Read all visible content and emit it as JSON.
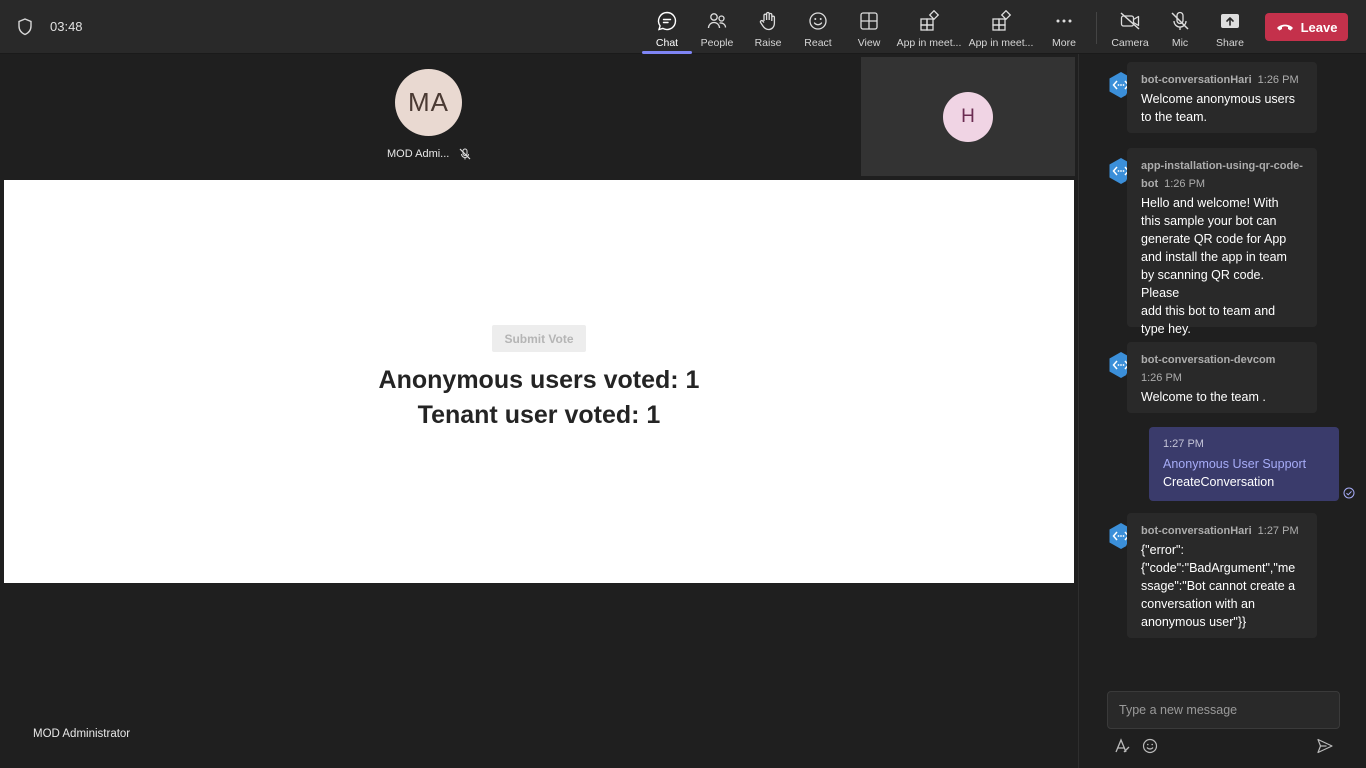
{
  "meeting": {
    "timer": "03:48",
    "toolbar": {
      "chat": "Chat",
      "people": "People",
      "raise": "Raise",
      "react": "React",
      "view": "View",
      "app1": "App in meet...",
      "app2": "App in meet...",
      "more": "More",
      "camera": "Camera",
      "mic": "Mic",
      "share": "Share",
      "leave": "Leave"
    },
    "participants": {
      "main": {
        "initials": "MA",
        "name": "MOD Admi..."
      },
      "tile": {
        "initials": "H"
      }
    },
    "stage": {
      "submit_label": "Submit Vote",
      "anonymous_votes": "Anonymous users voted: 1",
      "tenant_votes": "Tenant user voted: 1"
    },
    "self_name": "MOD Administrator"
  },
  "chat": {
    "messages": [
      {
        "sender": "bot-conversationHari",
        "time": "1:26 PM",
        "lines": [
          "Welcome anonymous users",
          "to the team."
        ]
      },
      {
        "sender_lines": [
          "app-installation-using-qr-code-",
          "bot"
        ],
        "time": "1:26 PM",
        "lines": [
          "Hello and welcome! With",
          "this sample your bot can",
          "generate QR code for App",
          "and install the app in team",
          "by scanning QR code. Please",
          "add this bot to team and",
          "type hey."
        ]
      },
      {
        "sender": "bot-conversation-devcom",
        "time": "1:26 PM",
        "lines": [
          "Welcome to the team ."
        ]
      },
      {
        "sender": "bot-conversationHari",
        "time": "1:27 PM",
        "lines": [
          "{\"error\":",
          "{\"code\":\"BadArgument\",\"me",
          "ssage\":\"Bot cannot create a",
          "conversation with an",
          "anonymous user\"}}"
        ]
      }
    ],
    "mine": {
      "time": "1:27 PM",
      "link": "Anonymous User Support",
      "command": "CreateConversation"
    },
    "compose_placeholder": "Type a new message"
  },
  "colors": {
    "accent": "#7f85f5",
    "leave": "#c4314b",
    "bubble_mine": "#3a3b6b",
    "bot_icon": "#3b8fd9"
  }
}
